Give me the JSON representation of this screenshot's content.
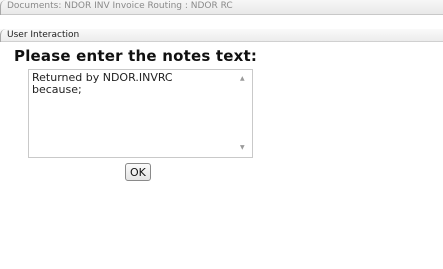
{
  "window": {
    "title": "Documents: NDOR INV Invoice Routing : NDOR RC"
  },
  "dialog": {
    "header": "User Interaction",
    "prompt": "Please enter the notes text:",
    "notes_value": "Returned by NDOR.INVRC\nbecause;",
    "ok_label": "OK"
  },
  "icons": {
    "scroll_up": "scroll-up-arrow-icon",
    "scroll_down": "scroll-down-arrow-icon"
  }
}
